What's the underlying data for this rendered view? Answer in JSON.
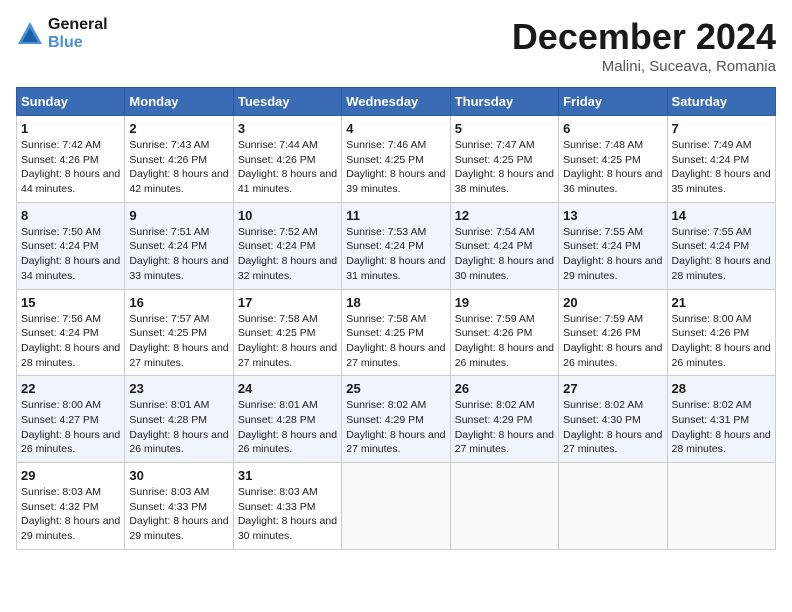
{
  "header": {
    "logo_line1": "General",
    "logo_line2": "Blue",
    "title": "December 2024",
    "subtitle": "Malini, Suceava, Romania"
  },
  "weekdays": [
    "Sunday",
    "Monday",
    "Tuesday",
    "Wednesday",
    "Thursday",
    "Friday",
    "Saturday"
  ],
  "weeks": [
    [
      {
        "day": "1",
        "sunrise": "Sunrise: 7:42 AM",
        "sunset": "Sunset: 4:26 PM",
        "daylight": "Daylight: 8 hours and 44 minutes."
      },
      {
        "day": "2",
        "sunrise": "Sunrise: 7:43 AM",
        "sunset": "Sunset: 4:26 PM",
        "daylight": "Daylight: 8 hours and 42 minutes."
      },
      {
        "day": "3",
        "sunrise": "Sunrise: 7:44 AM",
        "sunset": "Sunset: 4:26 PM",
        "daylight": "Daylight: 8 hours and 41 minutes."
      },
      {
        "day": "4",
        "sunrise": "Sunrise: 7:46 AM",
        "sunset": "Sunset: 4:25 PM",
        "daylight": "Daylight: 8 hours and 39 minutes."
      },
      {
        "day": "5",
        "sunrise": "Sunrise: 7:47 AM",
        "sunset": "Sunset: 4:25 PM",
        "daylight": "Daylight: 8 hours and 38 minutes."
      },
      {
        "day": "6",
        "sunrise": "Sunrise: 7:48 AM",
        "sunset": "Sunset: 4:25 PM",
        "daylight": "Daylight: 8 hours and 36 minutes."
      },
      {
        "day": "7",
        "sunrise": "Sunrise: 7:49 AM",
        "sunset": "Sunset: 4:24 PM",
        "daylight": "Daylight: 8 hours and 35 minutes."
      }
    ],
    [
      {
        "day": "8",
        "sunrise": "Sunrise: 7:50 AM",
        "sunset": "Sunset: 4:24 PM",
        "daylight": "Daylight: 8 hours and 34 minutes."
      },
      {
        "day": "9",
        "sunrise": "Sunrise: 7:51 AM",
        "sunset": "Sunset: 4:24 PM",
        "daylight": "Daylight: 8 hours and 33 minutes."
      },
      {
        "day": "10",
        "sunrise": "Sunrise: 7:52 AM",
        "sunset": "Sunset: 4:24 PM",
        "daylight": "Daylight: 8 hours and 32 minutes."
      },
      {
        "day": "11",
        "sunrise": "Sunrise: 7:53 AM",
        "sunset": "Sunset: 4:24 PM",
        "daylight": "Daylight: 8 hours and 31 minutes."
      },
      {
        "day": "12",
        "sunrise": "Sunrise: 7:54 AM",
        "sunset": "Sunset: 4:24 PM",
        "daylight": "Daylight: 8 hours and 30 minutes."
      },
      {
        "day": "13",
        "sunrise": "Sunrise: 7:55 AM",
        "sunset": "Sunset: 4:24 PM",
        "daylight": "Daylight: 8 hours and 29 minutes."
      },
      {
        "day": "14",
        "sunrise": "Sunrise: 7:55 AM",
        "sunset": "Sunset: 4:24 PM",
        "daylight": "Daylight: 8 hours and 28 minutes."
      }
    ],
    [
      {
        "day": "15",
        "sunrise": "Sunrise: 7:56 AM",
        "sunset": "Sunset: 4:24 PM",
        "daylight": "Daylight: 8 hours and 28 minutes."
      },
      {
        "day": "16",
        "sunrise": "Sunrise: 7:57 AM",
        "sunset": "Sunset: 4:25 PM",
        "daylight": "Daylight: 8 hours and 27 minutes."
      },
      {
        "day": "17",
        "sunrise": "Sunrise: 7:58 AM",
        "sunset": "Sunset: 4:25 PM",
        "daylight": "Daylight: 8 hours and 27 minutes."
      },
      {
        "day": "18",
        "sunrise": "Sunrise: 7:58 AM",
        "sunset": "Sunset: 4:25 PM",
        "daylight": "Daylight: 8 hours and 27 minutes."
      },
      {
        "day": "19",
        "sunrise": "Sunrise: 7:59 AM",
        "sunset": "Sunset: 4:26 PM",
        "daylight": "Daylight: 8 hours and 26 minutes."
      },
      {
        "day": "20",
        "sunrise": "Sunrise: 7:59 AM",
        "sunset": "Sunset: 4:26 PM",
        "daylight": "Daylight: 8 hours and 26 minutes."
      },
      {
        "day": "21",
        "sunrise": "Sunrise: 8:00 AM",
        "sunset": "Sunset: 4:26 PM",
        "daylight": "Daylight: 8 hours and 26 minutes."
      }
    ],
    [
      {
        "day": "22",
        "sunrise": "Sunrise: 8:00 AM",
        "sunset": "Sunset: 4:27 PM",
        "daylight": "Daylight: 8 hours and 26 minutes."
      },
      {
        "day": "23",
        "sunrise": "Sunrise: 8:01 AM",
        "sunset": "Sunset: 4:28 PM",
        "daylight": "Daylight: 8 hours and 26 minutes."
      },
      {
        "day": "24",
        "sunrise": "Sunrise: 8:01 AM",
        "sunset": "Sunset: 4:28 PM",
        "daylight": "Daylight: 8 hours and 26 minutes."
      },
      {
        "day": "25",
        "sunrise": "Sunrise: 8:02 AM",
        "sunset": "Sunset: 4:29 PM",
        "daylight": "Daylight: 8 hours and 27 minutes."
      },
      {
        "day": "26",
        "sunrise": "Sunrise: 8:02 AM",
        "sunset": "Sunset: 4:29 PM",
        "daylight": "Daylight: 8 hours and 27 minutes."
      },
      {
        "day": "27",
        "sunrise": "Sunrise: 8:02 AM",
        "sunset": "Sunset: 4:30 PM",
        "daylight": "Daylight: 8 hours and 27 minutes."
      },
      {
        "day": "28",
        "sunrise": "Sunrise: 8:02 AM",
        "sunset": "Sunset: 4:31 PM",
        "daylight": "Daylight: 8 hours and 28 minutes."
      }
    ],
    [
      {
        "day": "29",
        "sunrise": "Sunrise: 8:03 AM",
        "sunset": "Sunset: 4:32 PM",
        "daylight": "Daylight: 8 hours and 29 minutes."
      },
      {
        "day": "30",
        "sunrise": "Sunrise: 8:03 AM",
        "sunset": "Sunset: 4:33 PM",
        "daylight": "Daylight: 8 hours and 29 minutes."
      },
      {
        "day": "31",
        "sunrise": "Sunrise: 8:03 AM",
        "sunset": "Sunset: 4:33 PM",
        "daylight": "Daylight: 8 hours and 30 minutes."
      },
      null,
      null,
      null,
      null
    ]
  ]
}
